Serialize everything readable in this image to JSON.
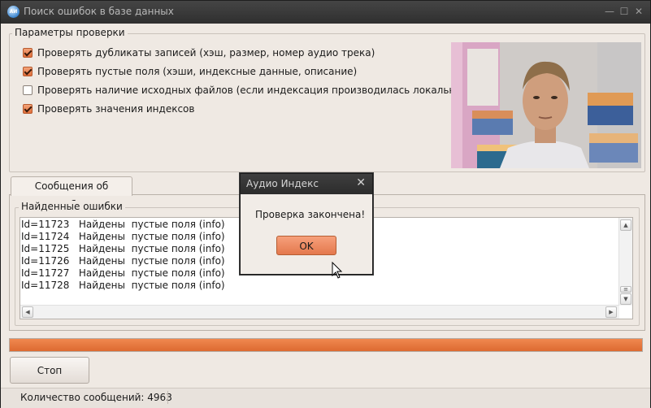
{
  "window": {
    "icon_text": "AИ",
    "title": "Поиск ошибок в базе данных",
    "min_glyph": "—",
    "max_glyph": "☐",
    "close_glyph": "✕"
  },
  "params": {
    "legend": "Параметры проверки",
    "checkboxes": [
      {
        "label": "Проверять дубликаты записей (хэш, размер, номер аудио трека)",
        "checked": true
      },
      {
        "label": "Проверять пустые поля (хэши, индексные данные, описание)",
        "checked": true
      },
      {
        "label": "Проверять наличие исходных файлов (если индексация производилась локально)",
        "checked": false
      },
      {
        "label": "Проверять значения индексов",
        "checked": true
      }
    ]
  },
  "tabs": [
    {
      "label": "Сообщения об ошибках",
      "active": true
    }
  ],
  "errors": {
    "legend": "Найденные ошибки",
    "rows": [
      "Id=11723   Найдены  пустые поля (info)",
      "Id=11724   Найдены  пустые поля (info)",
      "Id=11725   Найдены  пустые поля (info)",
      "Id=11726   Найдены  пустые поля (info)",
      "Id=11727   Найдены  пустые поля (info)",
      "Id=11728   Найдены  пустые поля (info)"
    ]
  },
  "progress": {
    "fraction": 1.0,
    "color": "#e5763f"
  },
  "stop_button": "Стоп",
  "status": {
    "message_count": "Количество сообщений: 4963"
  },
  "dialog": {
    "title": "Аудио Индекс",
    "close_glyph": "✕",
    "message": "Проверка закончена!",
    "ok_label": "OK"
  },
  "colors": {
    "accent": "#e5763f",
    "window_bg": "#efe9e3",
    "titlebar": "#383838"
  }
}
